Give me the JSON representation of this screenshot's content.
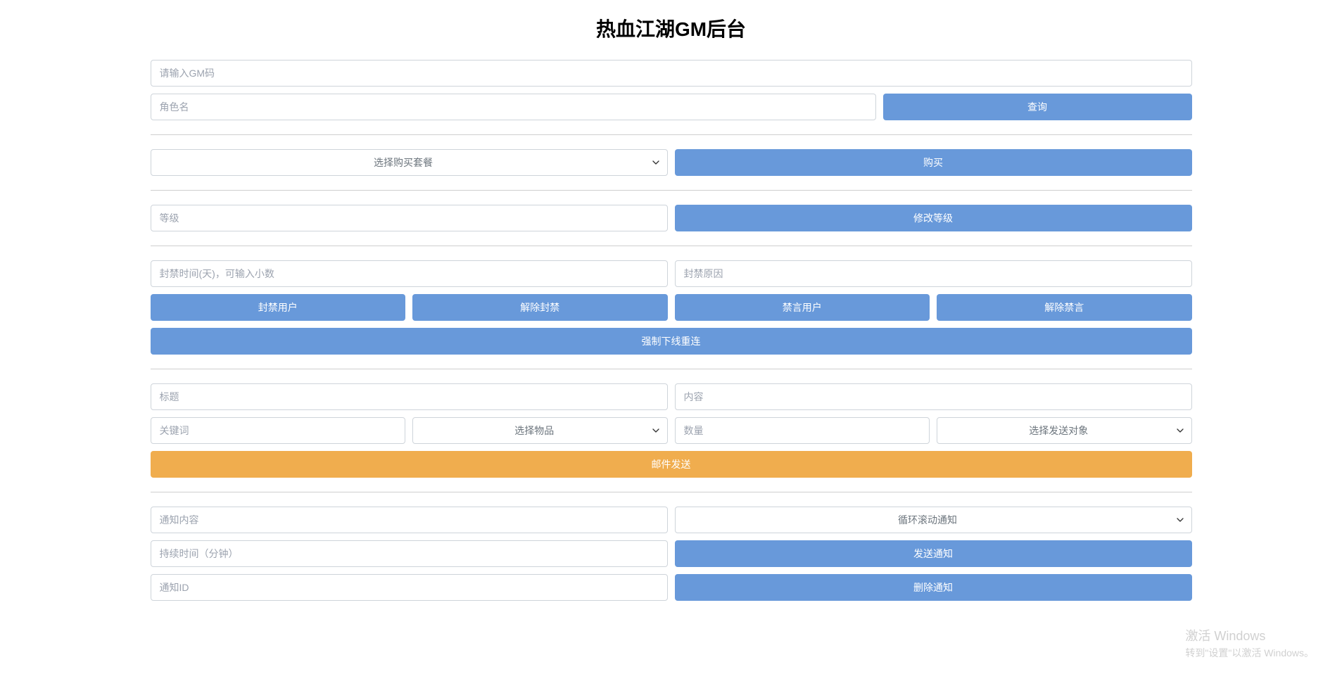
{
  "title": "热血江湖GM后台",
  "gmCode": {
    "placeholder": "请输入GM码"
  },
  "query": {
    "rolePlaceholder": "角色名",
    "buttonLabel": "查询"
  },
  "purchase": {
    "selectLabel": "选择购买套餐",
    "buttonLabel": "购买"
  },
  "level": {
    "placeholder": "等级",
    "buttonLabel": "修改等级"
  },
  "ban": {
    "timePlaceholder": "封禁时间(天)，可输入小数",
    "reasonPlaceholder": "封禁原因",
    "banUserLabel": "封禁用户",
    "unbanLabel": "解除封禁",
    "muteUserLabel": "禁言用户",
    "unmuteLabel": "解除禁言",
    "forceOfflineLabel": "强制下线重连"
  },
  "mail": {
    "titlePlaceholder": "标题",
    "contentPlaceholder": "内容",
    "keywordPlaceholder": "关键词",
    "itemSelectLabel": "选择物品",
    "quantityPlaceholder": "数量",
    "targetSelectLabel": "选择发送对象",
    "sendLabel": "邮件发送"
  },
  "notice": {
    "contentPlaceholder": "通知内容",
    "typeSelectLabel": "循环滚动通知",
    "durationPlaceholder": "持续时间（分钟）",
    "sendLabel": "发送通知",
    "idPlaceholder": "通知ID",
    "deleteLabel": "删除通知"
  },
  "watermark": {
    "title": "激活 Windows",
    "subtitle": "转到\"设置\"以激活 Windows。"
  }
}
